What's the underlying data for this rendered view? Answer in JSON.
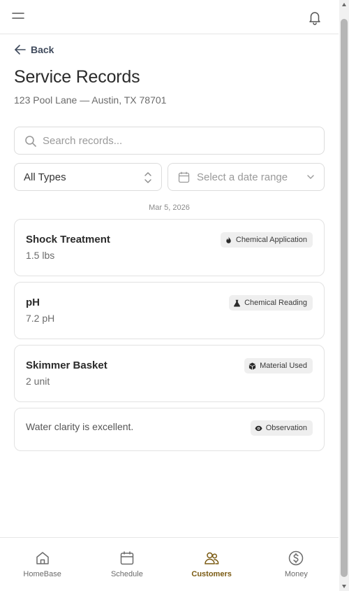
{
  "header": {
    "menu_icon": "hamburger-menu-icon",
    "notification_icon": "bell-icon"
  },
  "nav": {
    "back_label": "Back"
  },
  "page": {
    "title": "Service Records",
    "address": "123 Pool Lane — Austin, TX 78701"
  },
  "search": {
    "placeholder": "Search records...",
    "value": ""
  },
  "filters": {
    "type_value": "All Types",
    "date_placeholder": "Select a date range"
  },
  "date_group": "Mar 5, 2026",
  "records": [
    {
      "title": "Shock Treatment",
      "value": "1.5 lbs",
      "badge": "Chemical Application",
      "badge_icon": "flame-icon"
    },
    {
      "title": "pH",
      "value": "7.2 pH",
      "badge": "Chemical Reading",
      "badge_icon": "flask-icon"
    },
    {
      "title": "Skimmer Basket",
      "value": "2 unit",
      "badge": "Material Used",
      "badge_icon": "box-icon"
    },
    {
      "note": "Water clarity is excellent.",
      "badge": "Observation",
      "badge_icon": "eye-icon"
    }
  ],
  "bottom_nav": [
    {
      "label": "HomeBase",
      "icon": "home-icon"
    },
    {
      "label": "Schedule",
      "icon": "calendar-icon"
    },
    {
      "label": "Customers",
      "icon": "users-icon",
      "active": true
    },
    {
      "label": "Money",
      "icon": "dollar-icon"
    }
  ],
  "colors": {
    "accent": "#7a5a12",
    "text": "#2b2b2b",
    "muted": "#6b6b6b",
    "badge_bg": "#efefef",
    "border": "#e2e2e2"
  }
}
